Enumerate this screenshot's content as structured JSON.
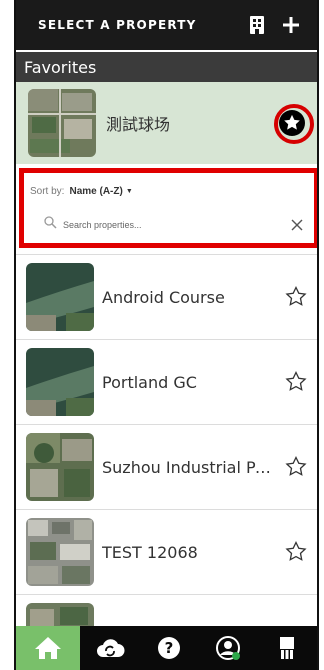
{
  "header": {
    "title": "SELECT A PROPERTY",
    "icons": [
      "building-icon",
      "plus-icon"
    ]
  },
  "favorites": {
    "heading": "Favorites",
    "items": [
      {
        "name": "測試球场",
        "starred": true,
        "thumb": "aerial-suburb"
      }
    ]
  },
  "filter": {
    "sort_label": "Sort by:",
    "sort_value": "Name (A-Z)",
    "search_placeholder": "Search properties...",
    "highlight_color": "#e00000"
  },
  "properties": [
    {
      "name": "Android Course",
      "starred": false,
      "thumb": "aerial-river"
    },
    {
      "name": "Portland GC",
      "starred": false,
      "thumb": "aerial-river"
    },
    {
      "name": "Suzhou Industrial Par...",
      "starred": false,
      "thumb": "aerial-town"
    },
    {
      "name": "TEST 12068",
      "starred": false,
      "thumb": "aerial-city"
    }
  ],
  "bottom_nav": {
    "items": [
      "home-icon",
      "cloud-sync-icon",
      "help-icon",
      "account-icon",
      "tools-icon"
    ],
    "active": "home-icon",
    "active_color": "#79c06a"
  }
}
